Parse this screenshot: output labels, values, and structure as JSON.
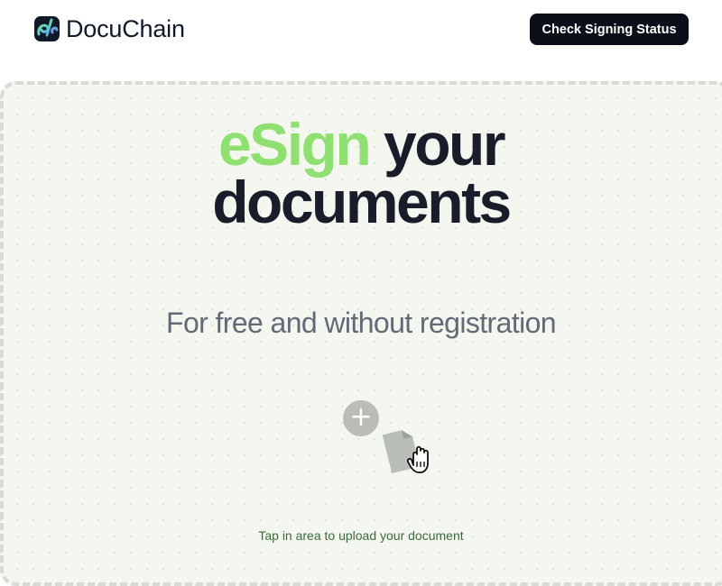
{
  "header": {
    "brand_name": "DocuChain",
    "logo_icon": "docuchain-logo-icon",
    "status_button_label": "Check Signing Status"
  },
  "hero": {
    "accent_word": "eSign",
    "title_rest_line1": " your",
    "title_line2": "documents",
    "subtitle": "For free and without registration"
  },
  "upload": {
    "plus_glyph": "+",
    "plus_icon": "plus-icon",
    "document_icon": "document-hand-icon",
    "hint": "Tap in area to upload your document"
  },
  "colors": {
    "accent": "#8fe070",
    "heading": "#1a1d29",
    "button_bg": "#0b0f19",
    "zone_bg": "#f4f6f0",
    "hint_text": "#3c6b3a"
  }
}
